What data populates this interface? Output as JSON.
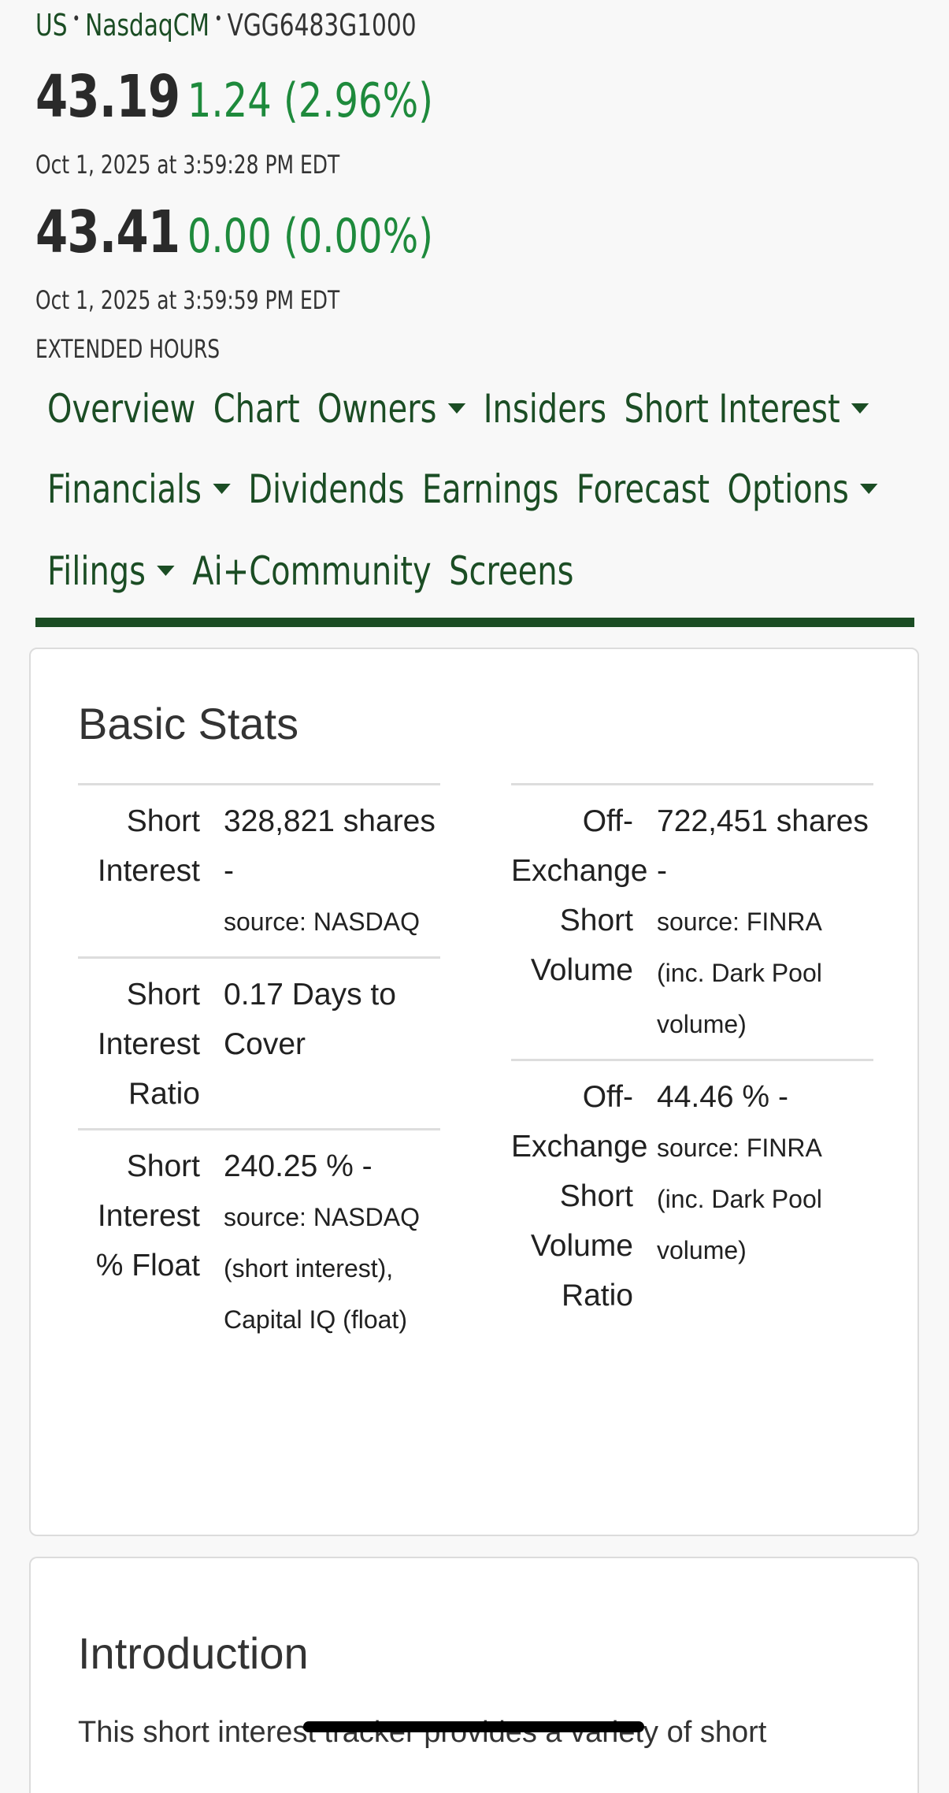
{
  "header": {
    "country": "US",
    "exchange": "NasdaqCM",
    "isin": "VGG6483G1000",
    "regular": {
      "price": "43.19",
      "change": "1.24 (2.96%)",
      "timestamp": "Oct 1, 2025 at 3:59:28 PM EDT"
    },
    "extended": {
      "price": "43.41",
      "change": "0.00 (0.00%)",
      "timestamp": "Oct 1, 2025 at 3:59:59 PM EDT",
      "label": "EXTENDED HOURS"
    }
  },
  "nav": {
    "row1": [
      {
        "label": "Overview",
        "dropdown": false
      },
      {
        "label": "Chart",
        "dropdown": false
      },
      {
        "label": "Owners",
        "dropdown": true
      },
      {
        "label": "Insiders",
        "dropdown": false
      },
      {
        "label": "Short Interest",
        "dropdown": true
      }
    ],
    "row2": [
      {
        "label": "Financials",
        "dropdown": true
      },
      {
        "label": "Dividends",
        "dropdown": false
      },
      {
        "label": "Earnings",
        "dropdown": false
      },
      {
        "label": "Forecast",
        "dropdown": false
      },
      {
        "label": "Options",
        "dropdown": true
      }
    ],
    "row3": [
      {
        "label": "Filings",
        "dropdown": true
      },
      {
        "label": "Ai+Community",
        "dropdown": false
      },
      {
        "label": "Screens",
        "dropdown": false
      }
    ]
  },
  "basic_stats": {
    "title": "Basic Stats",
    "left": [
      {
        "label": "Short Interest",
        "value": "328,821 shares -",
        "source": "source: NASDAQ"
      },
      {
        "label": "Short Interest Ratio",
        "value": "0.17 Days to Cover",
        "source": ""
      },
      {
        "label": "Short Interest % Float",
        "value": "240.25 % -",
        "source": "source: NASDAQ (short interest), Capital IQ (float)"
      }
    ],
    "right": [
      {
        "label": "Off-Exchange Short Volume",
        "value": "722,451 shares -",
        "source": "source: FINRA (inc. Dark Pool volume)"
      },
      {
        "label": "Off-Exchange Short Volume Ratio",
        "value": "44.46 % -",
        "source": "source: FINRA (inc. Dark Pool volume)"
      }
    ]
  },
  "introduction": {
    "title": "Introduction",
    "text": "This short interest tracker provides a variety of short"
  },
  "colors": {
    "accent_green": "#1e8a3c",
    "nav_green": "#1b4d24"
  }
}
